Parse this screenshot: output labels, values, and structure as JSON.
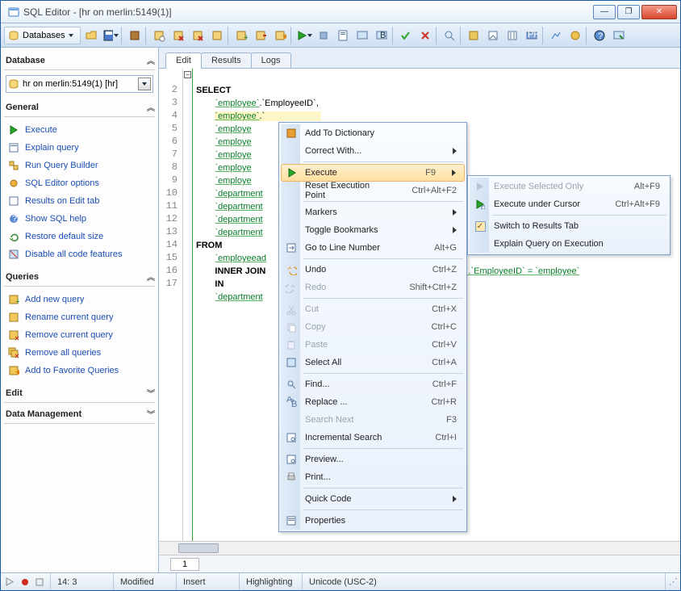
{
  "window": {
    "title": "SQL Editor - [hr on merlin:5149(1)]"
  },
  "toolbar": {
    "databases_label": "Databases"
  },
  "sidebar": {
    "sections": {
      "database": "Database",
      "general": "General",
      "queries": "Queries",
      "edit": "Edit",
      "data_mgmt": "Data Management"
    },
    "db_value": "hr on merlin:5149(1) [hr]",
    "general_links": [
      "Execute",
      "Explain query",
      "Run Query Builder",
      "SQL Editor options",
      "Results on Edit tab",
      "Show SQL help",
      "Restore default size",
      "Disable all code features"
    ],
    "query_links": [
      "Add new query",
      "Rename current query",
      "Remove current query",
      "Remove all queries",
      "Add to Favorite Queries"
    ]
  },
  "tabs": {
    "edit": "Edit",
    "results": "Results",
    "logs": "Logs"
  },
  "editor": {
    "lines": [
      "",
      "2",
      "3",
      "4",
      "5",
      "6",
      "7",
      "8",
      "9",
      "10",
      "11",
      "12",
      "13",
      "14",
      "15",
      "16",
      "17"
    ],
    "code": {
      "l1": "SELECT",
      "l2a": "`employee`",
      "l2b": ".`EmployeeID`,",
      "l3a": "`employee`",
      "l3b": ".`",
      "l4": "`employe",
      "l5": "`employe",
      "l6": "`employe",
      "l7": "`employe",
      "l8": "`employe",
      "l9": "`department",
      "l10": "`department",
      "l11": "`department",
      "l12": "`department",
      "l13": "FROM",
      "l14": "`employeead",
      "l15a": "INNER JOIN",
      "l15b": "s`.`EmployeeID` = `employee`",
      "l16": "IN",
      "l17": "`department"
    },
    "page": "1"
  },
  "status": {
    "pos": "14:   3",
    "modified": "Modified",
    "insert": "Insert",
    "highlighting": "Highlighting",
    "encoding": "Unicode (USC-2)"
  },
  "context_menu": {
    "items": [
      {
        "label": "Add To Dictionary",
        "icon": "book"
      },
      {
        "label": "Correct With...",
        "sub": true
      },
      {
        "sep": true
      },
      {
        "label": "Execute",
        "shortcut": "F9",
        "icon": "play",
        "hl": true,
        "sub": true
      },
      {
        "label": "Reset Execution Point",
        "shortcut": "Ctrl+Alt+F2"
      },
      {
        "sep": true
      },
      {
        "label": "Markers",
        "sub": true
      },
      {
        "label": "Toggle Bookmarks",
        "sub": true
      },
      {
        "label": "Go to Line Number",
        "shortcut": "Alt+G",
        "icon": "goto"
      },
      {
        "sep": true
      },
      {
        "label": "Undo",
        "shortcut": "Ctrl+Z",
        "icon": "undo"
      },
      {
        "label": "Redo",
        "shortcut": "Shift+Ctrl+Z",
        "icon": "redo",
        "dim": true
      },
      {
        "sep": true
      },
      {
        "label": "Cut",
        "shortcut": "Ctrl+X",
        "icon": "cut",
        "dim": true
      },
      {
        "label": "Copy",
        "shortcut": "Ctrl+C",
        "icon": "copy",
        "dim": true
      },
      {
        "label": "Paste",
        "shortcut": "Ctrl+V",
        "icon": "paste",
        "dim": true
      },
      {
        "label": "Select All",
        "shortcut": "Ctrl+A",
        "icon": "selall"
      },
      {
        "sep": true
      },
      {
        "label": "Find...",
        "shortcut": "Ctrl+F",
        "icon": "find"
      },
      {
        "label": "Replace ...",
        "shortcut": "Ctrl+R",
        "icon": "replace"
      },
      {
        "label": "Search Next",
        "shortcut": "F3",
        "dim": true
      },
      {
        "label": "Incremental Search",
        "shortcut": "Ctrl+I",
        "icon": "isearch"
      },
      {
        "sep": true
      },
      {
        "label": "Preview...",
        "icon": "preview"
      },
      {
        "label": "Print...",
        "icon": "print"
      },
      {
        "sep": true
      },
      {
        "label": "Quick Code",
        "sub": true
      },
      {
        "sep": true
      },
      {
        "label": "Properties",
        "icon": "props"
      }
    ],
    "submenu": [
      {
        "label": "Execute Selected Only",
        "shortcut": "Alt+F9",
        "icon": "playsel",
        "dim": true
      },
      {
        "label": "Execute under Cursor",
        "shortcut": "Ctrl+Alt+F9",
        "icon": "playcur"
      },
      {
        "sep": true
      },
      {
        "label": "Switch to Results Tab",
        "check": true
      },
      {
        "label": "Explain Query on Execution"
      }
    ]
  }
}
